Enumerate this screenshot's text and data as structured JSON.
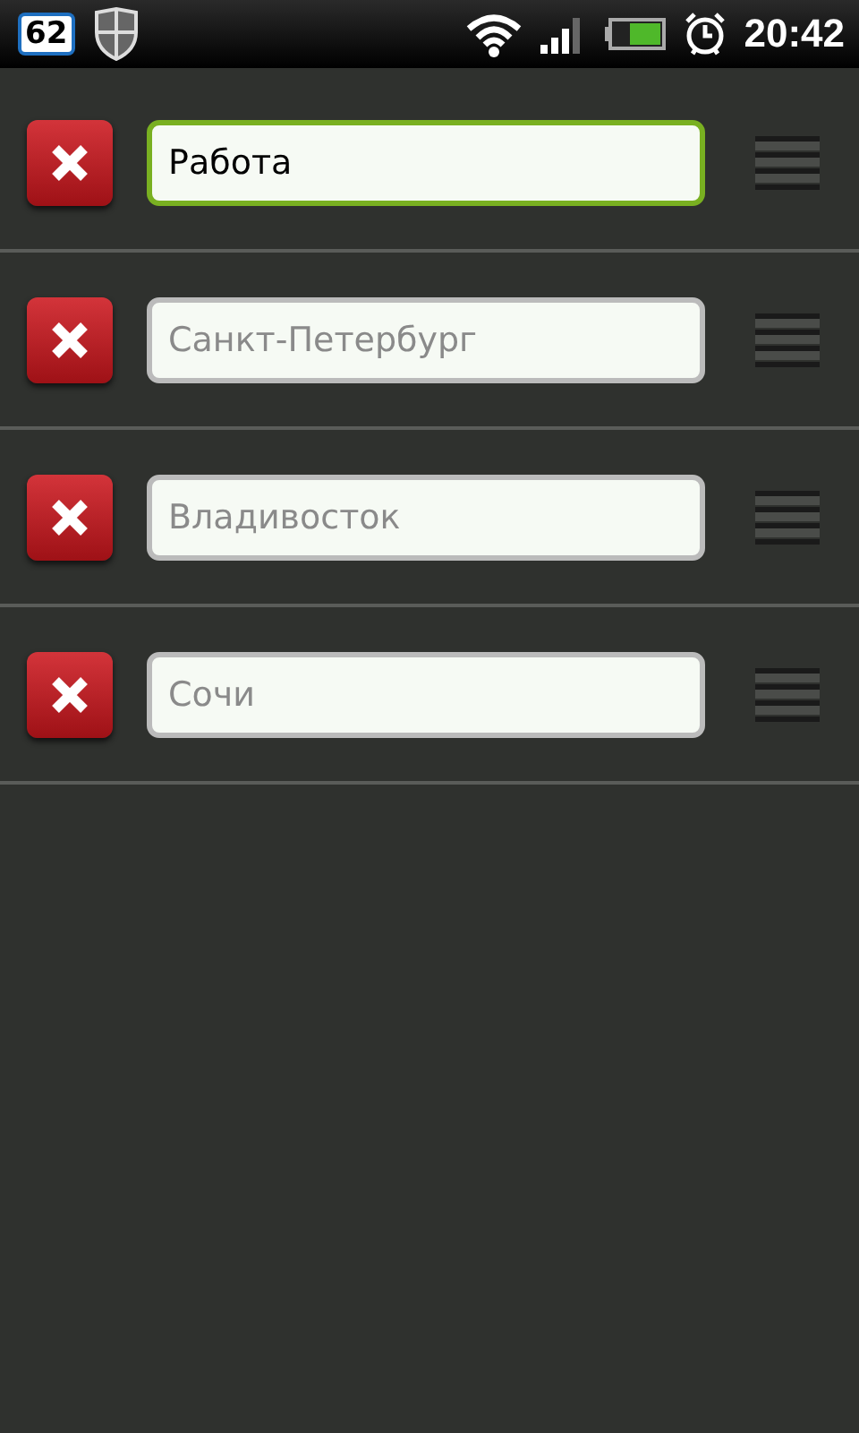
{
  "status_bar": {
    "badge": "62",
    "time": "20:42"
  },
  "items": [
    {
      "value": "Работа",
      "focused": true
    },
    {
      "placeholder": "Санкт-Петербург",
      "focused": false
    },
    {
      "placeholder": "Владивосток",
      "focused": false
    },
    {
      "placeholder": "Сочи",
      "focused": false
    }
  ]
}
